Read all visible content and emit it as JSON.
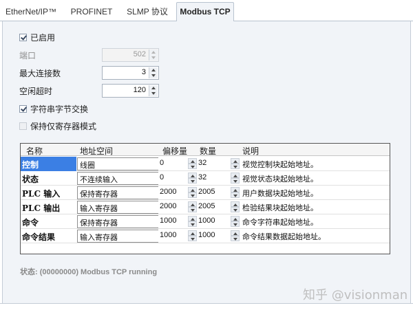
{
  "tabs": [
    {
      "label": "EtherNet/IP™",
      "active": false
    },
    {
      "label": "PROFINET",
      "active": false
    },
    {
      "label": "SLMP 协议",
      "active": false
    },
    {
      "label": "Modbus TCP",
      "active": true
    }
  ],
  "enabled": {
    "label": "已启用",
    "checked": true
  },
  "fields": {
    "port": {
      "label": "端口",
      "value": "502",
      "disabled": true
    },
    "max_connections": {
      "label": "最大连接数",
      "value": "3"
    },
    "idle_timeout": {
      "label": "空闲超时",
      "value": "120"
    }
  },
  "options": {
    "string_byte_swap": {
      "label": "字符串字节交换",
      "checked": true
    },
    "holding_only": {
      "label": "保持仅寄存器模式",
      "checked": false,
      "disabled": true
    }
  },
  "table": {
    "headers": {
      "name": "名称",
      "address_space": "地址空间",
      "offset": "偏移量",
      "count": "数量",
      "description": "说明"
    },
    "rows": [
      {
        "name": "控制",
        "address_space": "线圈",
        "offset": "0",
        "count": "32",
        "description": "视觉控制块起始地址。",
        "selected": true
      },
      {
        "name": "状态",
        "address_space": "不连续输入",
        "offset": "0",
        "count": "32",
        "description": "视觉状态块起始地址。"
      },
      {
        "name": "PLC 输入",
        "address_space": "保持寄存器",
        "offset": "2000",
        "count": "2005",
        "description": "用户数据块起始地址。"
      },
      {
        "name": "PLC 输出",
        "address_space": "输入寄存器",
        "offset": "2000",
        "count": "2005",
        "description": "检验结果块起始地址。"
      },
      {
        "name": "命令",
        "address_space": "保持寄存器",
        "offset": "1000",
        "count": "1000",
        "description": "命令字符串起始地址。"
      },
      {
        "name": "命令结果",
        "address_space": "输入寄存器",
        "offset": "1000",
        "count": "1000",
        "description": "命令结果数据起始地址。"
      }
    ]
  },
  "status": "状态: (00000000) Modbus TCP running",
  "watermark": "知乎 @visionman",
  "colors": {
    "selected_cell": "#3b7fe4",
    "panel_bg": "#f1f4f8"
  }
}
